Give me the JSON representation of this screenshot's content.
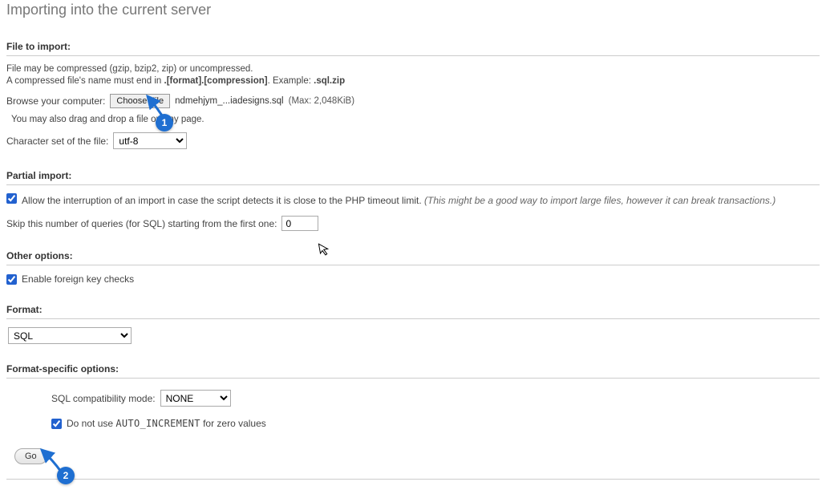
{
  "title": "Importing into the current server",
  "file_section": {
    "heading": "File to import:",
    "compress_line1": "File may be compressed (gzip, bzip2, zip) or uncompressed.",
    "compress_line2a": "A compressed file's name must end in ",
    "compress_line2b": ".[format].[compression]",
    "compress_line2c": ". Example: ",
    "compress_line2d": ".sql.zip",
    "browse_label": "Browse your computer:",
    "choose_file_btn": "Choose File",
    "chosen_filename": "ndmehjym_...iadesigns.sql",
    "max_size": "(Max: 2,048KiB)",
    "drag_hint": "You may also drag and drop a file on any page.",
    "charset_label": "Character set of the file:",
    "charset_value": "utf-8"
  },
  "partial": {
    "heading": "Partial import:",
    "allow_interrupt_checked": true,
    "allow_interrupt_label": "Allow the interruption of an import in case the script detects it is close to the PHP timeout limit.",
    "allow_interrupt_hint": "(This might be a good way to import large files, however it can break transactions.)",
    "skip_label": "Skip this number of queries (for SQL) starting from the first one:",
    "skip_value": "0"
  },
  "other": {
    "heading": "Other options:",
    "fk_checked": true,
    "fk_label": "Enable foreign key checks"
  },
  "format": {
    "heading": "Format:",
    "value": "SQL"
  },
  "specific": {
    "heading": "Format-specific options:",
    "compat_label": "SQL compatibility mode:",
    "compat_value": "NONE",
    "noauto_checked": true,
    "noauto_label_pre": "Do not use ",
    "noauto_kw": "AUTO_INCREMENT",
    "noauto_label_post": " for zero values"
  },
  "go_btn": "Go",
  "annotations": {
    "one": "1",
    "two": "2"
  }
}
